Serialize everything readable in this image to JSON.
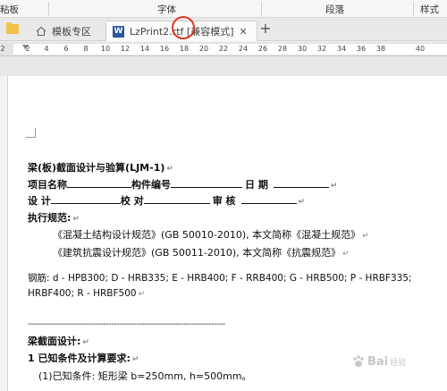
{
  "ribbon": {
    "groups": [
      {
        "label": "粘板"
      },
      {
        "label": "字体"
      },
      {
        "label": "段落"
      },
      {
        "label": "样式"
      }
    ]
  },
  "tabs": {
    "home_label": "模板专区",
    "doc_label": "LzPrint2.rtf [兼容模式]",
    "close_glyph": "✕",
    "add_glyph": "+"
  },
  "ruler": {
    "left_numbers": [
      "2"
    ],
    "numbers": [
      "2",
      "4",
      "6",
      "8",
      "10",
      "12",
      "14",
      "16",
      "18",
      "20",
      "22",
      "24",
      "26",
      "28",
      "30",
      "32",
      "34",
      "36",
      "38",
      "40"
    ]
  },
  "document": {
    "title": "梁(板)截面设计与验算(LJM-1)",
    "project_name_label": "项目名称",
    "member_no_label": "构件编号",
    "date_label": "日    期",
    "design_label": "设    计",
    "check_label": "校    对",
    "review_label": "审    核",
    "specs_title": "执行规范:",
    "spec1": "《混凝土结构设计规范》(GB 50010-2010),   本文简称《混凝土规范》",
    "spec2": "《建筑抗震设计规范》(GB 50011-2010),   本文简称《抗震规范》",
    "rebar_line1": "钢筋: d - HPB300; D - HRB335; E - HRB400; F - RRB400; G - HRB500; P - HRBF335;",
    "rebar_line2": "HRBF400; R - HRBF500",
    "dashes": "-----------------------------------------------------------------------",
    "section_design": "梁截面设计:",
    "known_conditions": "1 已知条件及计算要求:",
    "cond1": "(1)已知条件: 矩形梁        b=250mm, h=500mm。",
    "para_mark": "↵"
  },
  "watermark": {
    "brand": "Bai",
    "sub": "经验"
  },
  "colors": {
    "word_blue": "#2b579a",
    "annotation_red": "#d63b2a",
    "folder_yellow": "#f0c24a"
  }
}
